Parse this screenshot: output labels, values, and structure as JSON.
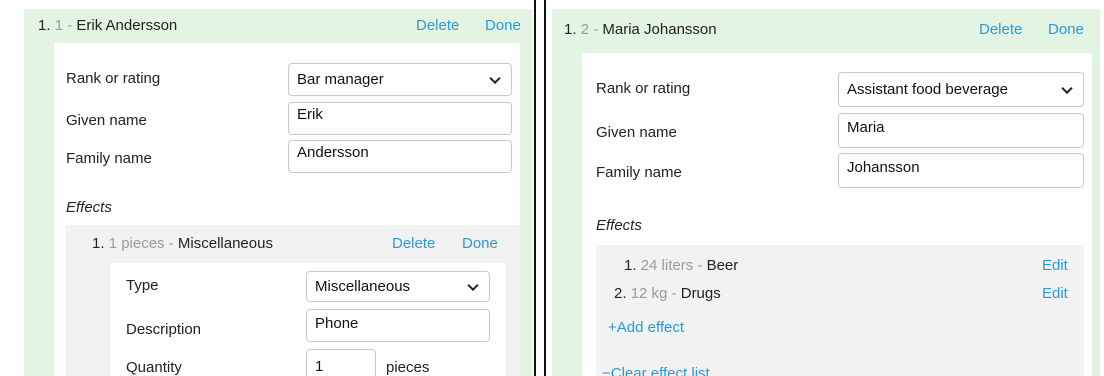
{
  "left": {
    "header": {
      "number": "1.",
      "index": "1",
      "separator": "-",
      "name": "Erik Andersson",
      "delete": "Delete",
      "done": "Done"
    },
    "rank_label": "Rank or rating",
    "rank_value": "Bar manager",
    "given_label": "Given name",
    "given_value": "Erik",
    "family_label": "Family name",
    "family_value": "Andersson",
    "effects_title": "Effects",
    "effect": {
      "number": "1.",
      "quantity": "1 pieces",
      "separator": "-",
      "name": "Miscellaneous",
      "delete": "Delete",
      "done": "Done",
      "type_label": "Type",
      "type_value": "Miscellaneous",
      "description_label": "Description",
      "description_value": "Phone",
      "quantity_label": "Quantity",
      "quantity_value": "1",
      "quantity_unit": "pieces"
    }
  },
  "right": {
    "header": {
      "number": "1.",
      "index": "2",
      "separator": "-",
      "name": "Maria Johansson",
      "delete": "Delete",
      "done": "Done"
    },
    "rank_label": "Rank or rating",
    "rank_value": "Assistant food beverage",
    "given_label": "Given name",
    "given_value": "Maria",
    "family_label": "Family name",
    "family_value": "Johansson",
    "effects_title": "Effects",
    "effects": [
      {
        "number": "1.",
        "quantity": "24 liters",
        "separator": "-",
        "name": "Beer",
        "edit": "Edit"
      },
      {
        "number": "2.",
        "quantity": "12 kg",
        "separator": "-",
        "name": "Drugs",
        "edit": "Edit"
      }
    ],
    "add_effect": "+Add effect",
    "clear_list": "−Clear effect list"
  },
  "colors": {
    "crew_bg": "#e3f4e3",
    "link": "#2a9ad6",
    "muted": "#9a9a9a",
    "effects_bg": "#f2f2f2"
  }
}
